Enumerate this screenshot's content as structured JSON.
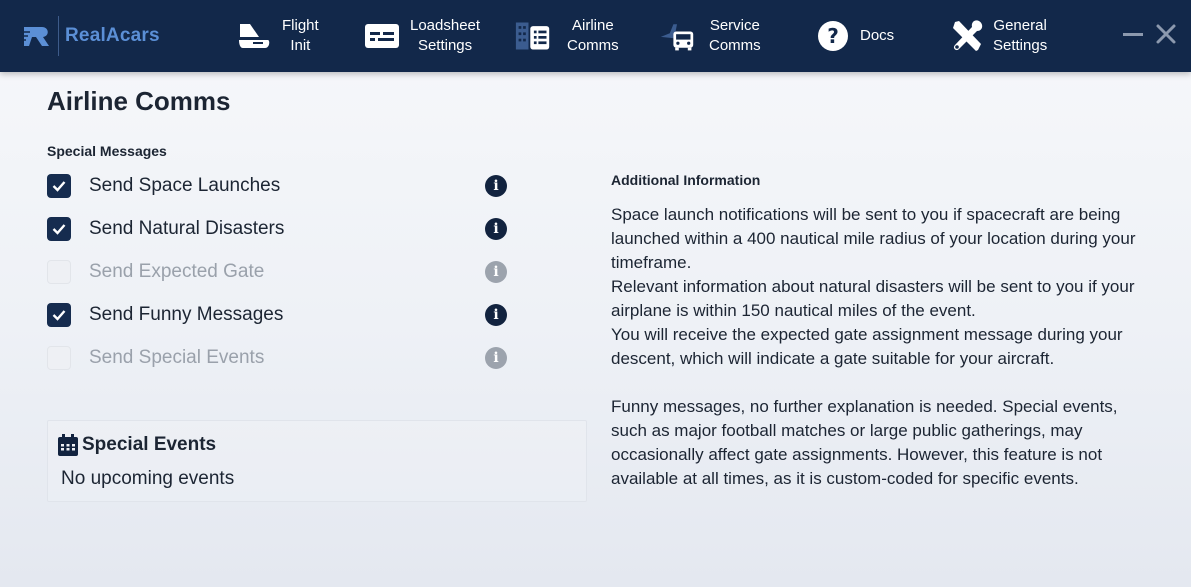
{
  "app": {
    "brand": "RealAcars",
    "colors": {
      "nav_bg": "#12284a",
      "accent": "#5b8fd6",
      "checkbox": "#162c4f"
    }
  },
  "nav": {
    "items": [
      {
        "line1": "Flight",
        "line2": "Init",
        "icon": "plane-icon"
      },
      {
        "line1": "Loadsheet",
        "line2": "Settings",
        "icon": "keyboard-icon"
      },
      {
        "line1": "Airline",
        "line2": "Comms",
        "icon": "building-icon"
      },
      {
        "line1": "Service",
        "line2": "Comms",
        "icon": "truck-icon"
      },
      {
        "line1": "Docs",
        "line2": "",
        "icon": "question-icon"
      },
      {
        "line1": "General",
        "line2": "Settings",
        "icon": "tools-icon"
      }
    ]
  },
  "page": {
    "title": "Airline Comms",
    "section_label": "Special Messages",
    "options": [
      {
        "label": "Send Space Launches",
        "checked": true,
        "enabled": true
      },
      {
        "label": "Send Natural Disasters",
        "checked": true,
        "enabled": true
      },
      {
        "label": "Send Expected Gate",
        "checked": false,
        "enabled": false
      },
      {
        "label": "Send Funny Messages",
        "checked": true,
        "enabled": true
      },
      {
        "label": "Send Special Events",
        "checked": false,
        "enabled": false
      }
    ],
    "events": {
      "title": "Special Events",
      "body": "No upcoming events"
    },
    "additional": {
      "title": "Additional Information",
      "p1": "Space launch notifications will be sent to you if spacecraft are being launched within a 400 nautical mile radius of your location during your timeframe.",
      "p2": "Relevant information about natural disasters will be sent to you if your airplane is within 150 nautical miles of the event.",
      "p3": "You will receive the expected gate assignment message during your descent, which will indicate a gate suitable for your aircraft.",
      "p4": "Funny messages, no further explanation is needed. Special events, such as major football matches or large public gatherings, may occasionally affect gate assignments. However, this feature is not available at all times, as it is custom-coded for specific events."
    }
  }
}
